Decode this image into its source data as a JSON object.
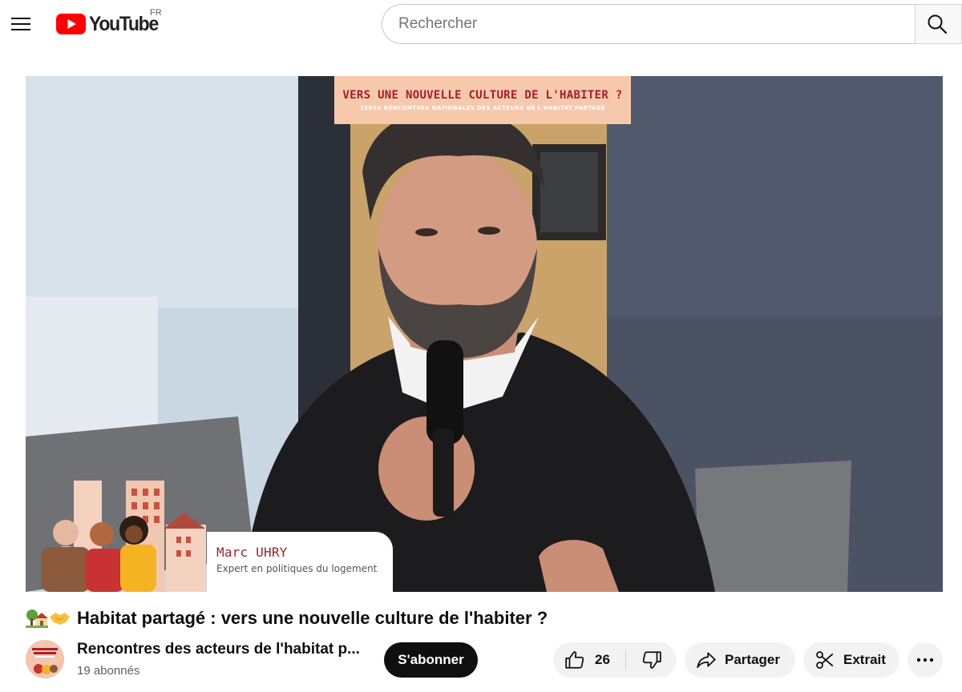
{
  "header": {
    "logo_text": "YouTube",
    "country_code": "FR",
    "search_placeholder": "Rechercher"
  },
  "video": {
    "banner_title": "VERS UNE NOUVELLE CULTURE DE L'HABITER ?",
    "banner_subtitle": "1ÈRES RENCONTRES NATIONALES DES ACTEURS DE L'HABITAT PARTAGÉ",
    "speaker_name": "Marc UHRY",
    "speaker_role": "Expert en politiques du logement"
  },
  "title": "Habitat partagé : vers une nouvelle culture de l'habiter ?",
  "title_emojis": [
    "house-with-garden",
    "handshake"
  ],
  "owner": {
    "channel_name": "Rencontres des acteurs de l'habitat p...",
    "subscribers": "19 abonnés",
    "subscribe_label": "S'abonner"
  },
  "actions": {
    "like_count": "26",
    "share_label": "Partager",
    "clip_label": "Extrait"
  },
  "colors": {
    "youtube_red": "#ff0000",
    "banner_bg": "#f6c9ad",
    "banner_title": "#a5202a"
  }
}
